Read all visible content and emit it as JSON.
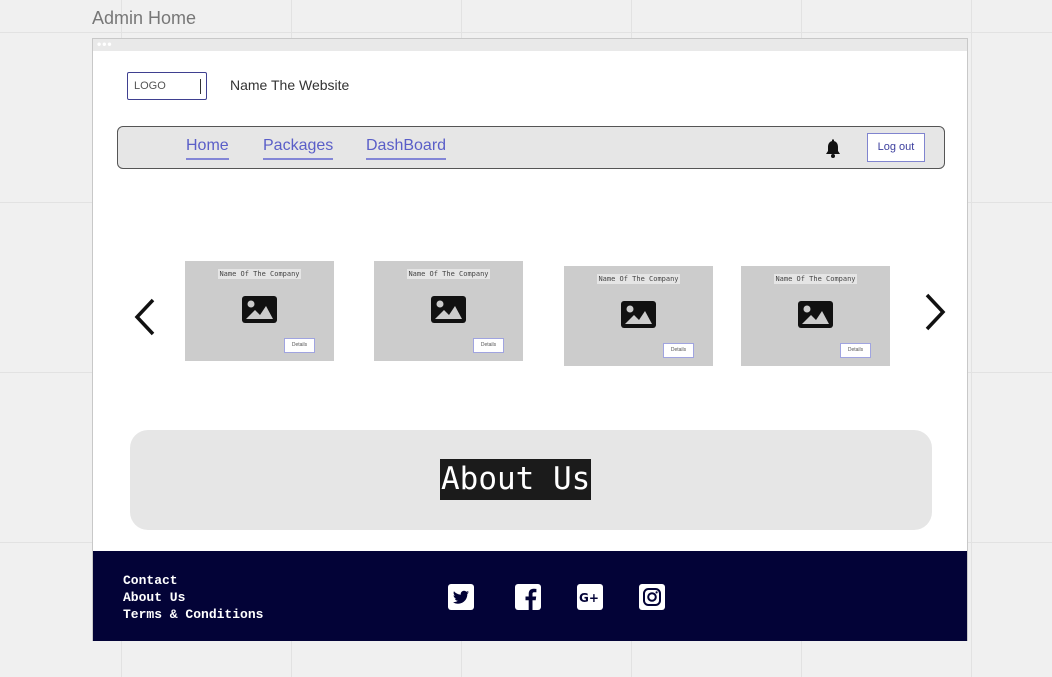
{
  "page": {
    "label": "Admin Home"
  },
  "header": {
    "logo_text": "LOGO",
    "site_name": "Name The Website"
  },
  "nav": {
    "links": [
      {
        "label": "Home"
      },
      {
        "label": "Packages"
      },
      {
        "label": "DashBoard"
      }
    ],
    "logout_label": "Log out",
    "notification_icon": "bell-icon"
  },
  "carousel": {
    "prev_icon": "chevron-left-icon",
    "next_icon": "chevron-right-icon",
    "cards": [
      {
        "company": "Name Of The Company",
        "button": "Details",
        "image_icon": "image-icon"
      },
      {
        "company": "Name Of The Company",
        "button": "Details",
        "image_icon": "image-icon"
      },
      {
        "company": "Name Of The Company",
        "button": "Details",
        "image_icon": "image-icon"
      },
      {
        "company": "Name Of The Company",
        "button": "Details",
        "image_icon": "image-icon"
      }
    ]
  },
  "about": {
    "title": "About Us"
  },
  "footer": {
    "links": [
      "Contact",
      "About Us",
      "Terms & Conditions"
    ],
    "social": [
      "twitter-icon",
      "facebook-icon",
      "google-plus-icon",
      "instagram-icon"
    ]
  },
  "colors": {
    "nav_link": "#5a5ec8",
    "footer_bg": "#030337",
    "card_bg": "#cccccc",
    "about_bg": "#e6e6e6"
  }
}
